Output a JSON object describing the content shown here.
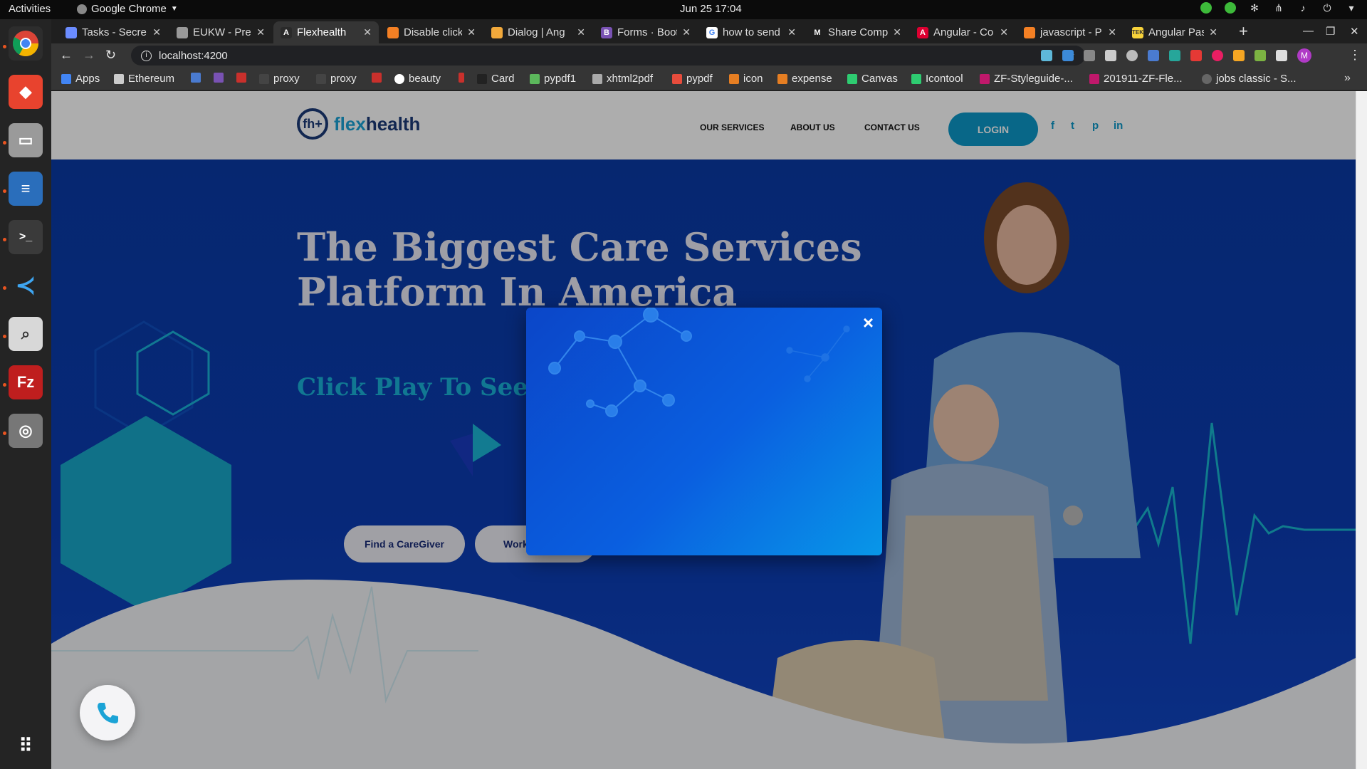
{
  "topbar": {
    "activities": "Activities",
    "app_menu": "Google Chrome",
    "clock": "Jun 25  17:04"
  },
  "tabs": [
    {
      "label": "Tasks - Secre",
      "icon": "tasks-icon",
      "color": "#6b8cff"
    },
    {
      "label": "EUKW - Preze",
      "icon": "page-icon",
      "color": "#999999"
    },
    {
      "label": "Flexhealth",
      "icon": "angular-icon",
      "color": "#ffffff"
    },
    {
      "label": "Disable click",
      "icon": "stackoverflow-icon",
      "color": "#f48024"
    },
    {
      "label": "Dialog | Ang",
      "icon": "shield-icon",
      "color": "#f2a93b"
    },
    {
      "label": "Forms · Boot",
      "icon": "bootstrap-icon",
      "color": "#7952b3"
    },
    {
      "label": "how to send",
      "icon": "google-icon",
      "color": "#4285f4"
    },
    {
      "label": "Share Comp",
      "icon": "medium-icon",
      "color": "#ffffff"
    },
    {
      "label": "Angular - Co",
      "icon": "angular-icon",
      "color": "#dd0031"
    },
    {
      "label": "javascript - P",
      "icon": "stackoverflow-icon",
      "color": "#f48024"
    },
    {
      "label": "Angular Pas",
      "icon": "tek-icon",
      "color": "#f7d23a"
    }
  ],
  "address": {
    "url": "localhost:4200"
  },
  "bookmarks": [
    {
      "label": "Apps",
      "color": "#4285f4"
    },
    {
      "label": "Ethereum",
      "color": "#cccccc"
    },
    {
      "label": "",
      "color": "#4a7bd0"
    },
    {
      "label": "",
      "color": "#7952b3"
    },
    {
      "label": "",
      "color": "#c9302c"
    },
    {
      "label": "proxy",
      "color": "#444444"
    },
    {
      "label": "proxy",
      "color": "#444444"
    },
    {
      "label": "",
      "color": "#c9302c"
    },
    {
      "label": "beauty",
      "color": "#ffffff"
    },
    {
      "label": "",
      "color": "#c9302c"
    },
    {
      "label": "Card",
      "color": "#222222"
    },
    {
      "label": "pypdf1",
      "color": "#5cb85c"
    },
    {
      "label": "xhtml2pdf",
      "color": "#aaaaaa"
    },
    {
      "label": "pypdf",
      "color": "#e74c3c"
    },
    {
      "label": "icon",
      "color": "#e67e22"
    },
    {
      "label": "expense",
      "color": "#e67e22"
    },
    {
      "label": "Canvas",
      "color": "#2ecc71"
    },
    {
      "label": "Icontool",
      "color": "#2ecc71"
    },
    {
      "label": "ZF-Styleguide-...",
      "color": "#c0186b"
    },
    {
      "label": "201911-ZF-Fle...",
      "color": "#c0186b"
    },
    {
      "label": "jobs classic - S...",
      "color": "#666666"
    }
  ],
  "site": {
    "logo_mark": "fh+",
    "logo_flex": "flex",
    "logo_health": "health",
    "nav": [
      "OUR SERVICES",
      "ABOUT US",
      "CONTACT US"
    ],
    "login": "LOGIN",
    "social": [
      "f",
      "t",
      "p",
      "in"
    ],
    "headline_1": "The Biggest Care Services",
    "headline_2": "Platform In America",
    "subline": "Click Play To See Ho",
    "btn_find": "Find a CareGiver",
    "btn_work": "Work"
  },
  "dialog": {
    "close": "×"
  },
  "colors": {
    "accent": "#0c98c9",
    "hero": "#0b3cb3",
    "teal": "#1ab2d8"
  }
}
